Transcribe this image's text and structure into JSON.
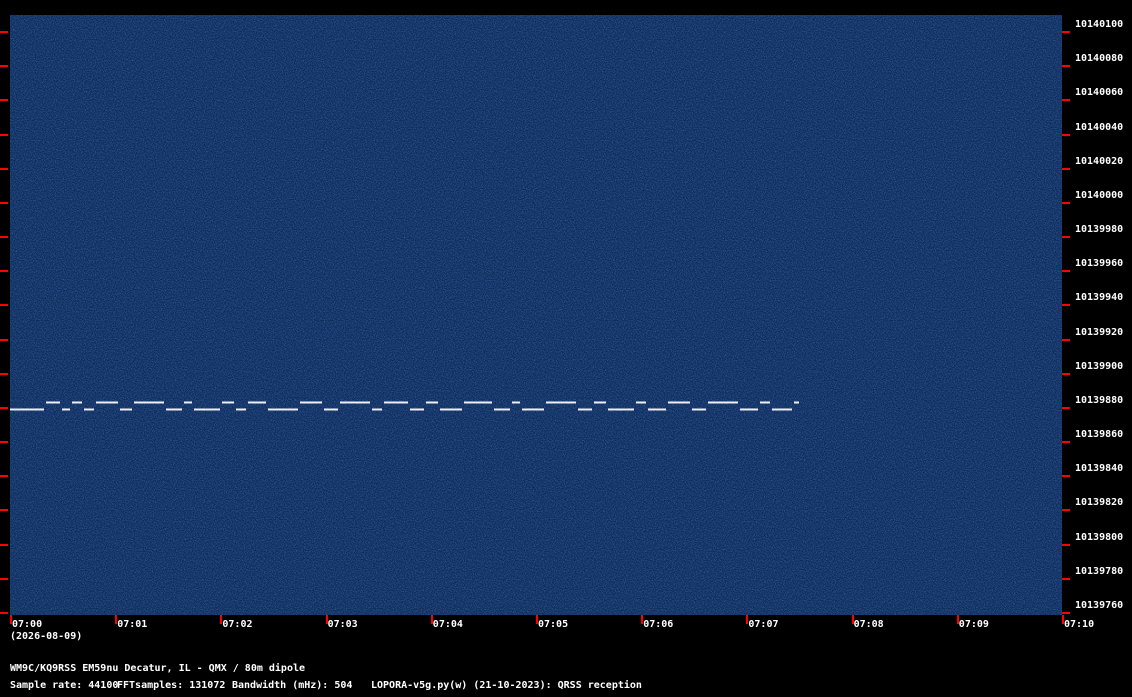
{
  "spectrogram": {
    "background_color": "#0b2a5c",
    "trace_color": "#ffffff",
    "tick_color": "#ff0000",
    "signal_frequency_hz": 10139875,
    "signal_start_time": "07:00",
    "signal_end_time": "07:07.5"
  },
  "freq_axis": {
    "labels": [
      "10140100",
      "10140080",
      "10140060",
      "10140040",
      "10140020",
      "10140000",
      "10139980",
      "10139960",
      "10139940",
      "10139920",
      "10139900",
      "10139880",
      "10139860",
      "10139840",
      "10139820",
      "10139800",
      "10139780",
      "10139760"
    ]
  },
  "time_axis": {
    "labels": [
      "07:00",
      "07:01",
      "07:02",
      "07:03",
      "07:04",
      "07:05",
      "07:06",
      "07:07",
      "07:08",
      "07:09",
      "07:10"
    ],
    "date": "(2026-08-09)"
  },
  "info": {
    "station": "WM9C/KQ9RSS EM59nu Decatur, IL - QMX / 80m dipole",
    "sample_rate": "Sample rate: 44100",
    "fft_samples": "FFTsamples: 131072",
    "bandwidth": "Bandwidth (mHz): 504",
    "software": "LOPORA-v5g.py(w) (21-10-2023): QRSS reception"
  }
}
